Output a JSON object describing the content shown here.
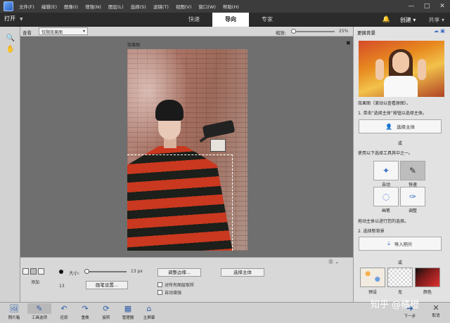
{
  "menubar": {
    "items": [
      "文件(F)",
      "编辑(E)",
      "图像(I)",
      "增强(N)",
      "图层(L)",
      "选择(S)",
      "滤镜(T)",
      "视图(V)",
      "窗口(W)",
      "帮助(H)"
    ],
    "controls": [
      "—",
      "□",
      "✕"
    ]
  },
  "modebar": {
    "open_label": "打开",
    "tabs": [
      "快速",
      "导向",
      "专家"
    ],
    "active_tab": "导向",
    "create_label": "创建",
    "share_label": "共享"
  },
  "options_bar": {
    "view_label": "查看",
    "view_value": "仅限效果图",
    "zoom_label": "缩放:",
    "zoom_value": "25%",
    "zoom_level": 0.05
  },
  "document": {
    "title": "效果图"
  },
  "tool_options": {
    "add_label": "添加",
    "size_label": "大小:",
    "size_value": "13 px",
    "brush_number": "13",
    "brush_settings_label": "画笔设置...",
    "refine_edge_label": "调整边缘...",
    "select_subject_label": "选择主体",
    "checkbox_sample_all": "对所有图层取样",
    "checkbox_auto_enhance": "自动增强"
  },
  "panel": {
    "title": "更换背景",
    "caption": "效果图（滚动以查看原图）。",
    "step1": "1. 单击“选择主体”按钮以选择主体。",
    "select_subject_button": "选择主体",
    "or_1": "或",
    "use_tools": "使用以下选择工具其中之一。",
    "quick_tools": [
      {
        "label": "自动",
        "icon": "magic-wand-icon"
      },
      {
        "label": "快速",
        "icon": "quick-selection-icon"
      },
      {
        "label": "画笔",
        "icon": "selection-brush-icon"
      },
      {
        "label": "调整",
        "icon": "refine-brush-icon"
      }
    ],
    "drag_hint": "拖动主体以进行您的选择。",
    "step2": "2. 选择新背景",
    "import_photo_button": "导入照片",
    "or_2": "或",
    "backgrounds": [
      "预设",
      "无",
      "颜色"
    ]
  },
  "bottombar": {
    "items": [
      "照片箱",
      "工具选项",
      "还原",
      "重做",
      "旋转",
      "管理器",
      "主屏幕"
    ],
    "next_label": "下一步",
    "cancel_label": "取消",
    "watermark": "知乎 @橘橙"
  },
  "colors": {
    "menubar_bg": "#3c3c3c",
    "modebar_bg": "#2b2b2b",
    "accent_blue": "#3a6ec4",
    "canvas_bg": "#6f6f6f"
  }
}
